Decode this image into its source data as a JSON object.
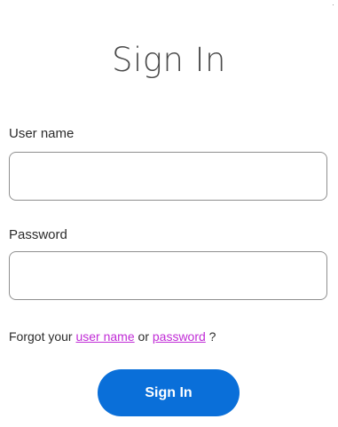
{
  "page": {
    "title": "Sign In"
  },
  "form": {
    "username": {
      "label": "User name",
      "value": "",
      "placeholder": ""
    },
    "password": {
      "label": "Password",
      "value": "",
      "placeholder": ""
    },
    "forgot": {
      "prefix": "Forgot your ",
      "username_link": "user name",
      "connector": " or ",
      "password_link": "password",
      "suffix": " ?"
    },
    "submit_label": "Sign In"
  },
  "colors": {
    "accent": "#0a6fd9",
    "link": "#c02bd6",
    "field_border": "#8f8f8f"
  }
}
